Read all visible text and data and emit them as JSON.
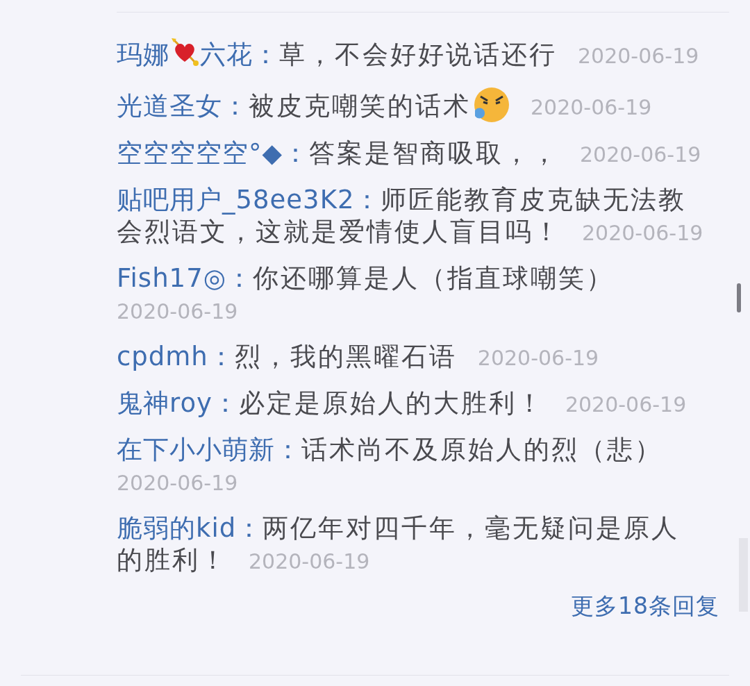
{
  "replies": [
    {
      "parts": [
        {
          "kind": "name",
          "text": "玛娜"
        },
        {
          "kind": "heart"
        },
        {
          "kind": "name",
          "text": "六花："
        },
        {
          "kind": "text",
          "text": "草，不会好好说话还行"
        }
      ],
      "date": "2020-06-19"
    },
    {
      "parts": [
        {
          "kind": "name",
          "text": "光道圣女："
        },
        {
          "kind": "text",
          "text": "被皮克嘲笑的话术"
        },
        {
          "kind": "angry"
        }
      ],
      "date": "2020-06-19"
    },
    {
      "parts": [
        {
          "kind": "name",
          "text": "空空空空空°◆："
        },
        {
          "kind": "text",
          "text": "答案是智商吸取，，"
        }
      ],
      "date": "2020-06-19"
    },
    {
      "parts": [
        {
          "kind": "name",
          "text": "贴吧用户_58ee3K2："
        },
        {
          "kind": "text",
          "text": "师匠能教育皮克缺无法教"
        },
        {
          "kind": "break"
        },
        {
          "kind": "text",
          "text": "会烈语文，这就是爱情使人盲目吗！"
        }
      ],
      "date": "2020-06-19"
    },
    {
      "parts": [
        {
          "kind": "name",
          "text": "Fish17◎："
        },
        {
          "kind": "text",
          "text": "你还哪算是人（指直球嘲笑）"
        }
      ],
      "date": "2020-06-19"
    },
    {
      "parts": [
        {
          "kind": "name",
          "text": "cpdmh："
        },
        {
          "kind": "text",
          "text": "烈，我的黑曜石语"
        }
      ],
      "date": "2020-06-19"
    },
    {
      "parts": [
        {
          "kind": "name",
          "text": "鬼神roy："
        },
        {
          "kind": "text",
          "text": "必定是原始人的大胜利！"
        }
      ],
      "date": "2020-06-19"
    },
    {
      "parts": [
        {
          "kind": "name",
          "text": "在下小小萌新："
        },
        {
          "kind": "text",
          "text": "话术尚不及原始人的烈（悲）"
        }
      ],
      "date": "2020-06-19"
    },
    {
      "parts": [
        {
          "kind": "name",
          "text": "脆弱的kid："
        },
        {
          "kind": "text",
          "text": "两亿年对四千年，毫无疑问是原人"
        },
        {
          "kind": "break"
        },
        {
          "kind": "text",
          "text": "的胜利！"
        }
      ],
      "date": "2020-06-19"
    }
  ],
  "more_link": "更多18条回复"
}
